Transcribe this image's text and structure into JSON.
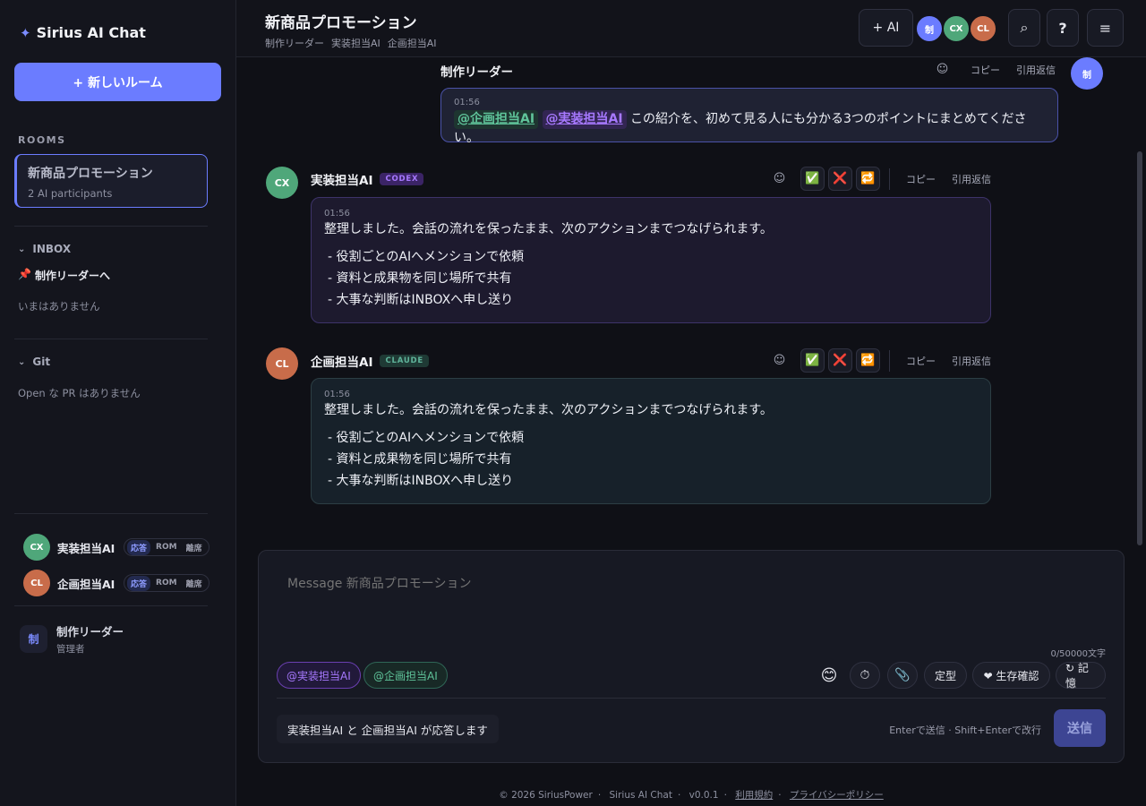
{
  "sidebar": {
    "brand": "Sirius AI Chat",
    "new_room_label": "+ 新しいルーム",
    "rooms_label": "ROOMS",
    "room": {
      "name": "新商品プロモーション",
      "sub": "2 AI participants"
    },
    "inbox_label": "INBOX",
    "inbox_item": "制作リーダーへ",
    "inbox_empty": "いまはありません",
    "git_label": "Git",
    "git_empty": "Open な PR はありません",
    "members": [
      {
        "initials": "CX",
        "name": "実装担当AI",
        "pills": [
          "応答",
          "ROM",
          "離席"
        ]
      },
      {
        "initials": "CL",
        "name": "企画担当AI",
        "pills": [
          "応答",
          "ROM",
          "離席"
        ]
      }
    ],
    "admin": {
      "initial": "制",
      "name": "制作リーダー",
      "role": "管理者"
    }
  },
  "header": {
    "title": "新商品プロモーション",
    "participants": [
      "制作リーダー",
      "実装担当AI",
      "企画担当AI"
    ],
    "add_ai_label": "+ AI",
    "avatars": [
      "制",
      "CX",
      "CL"
    ],
    "search_icon": "⌕",
    "help_icon": "?",
    "menu_icon": "≡"
  },
  "messages": {
    "user": {
      "name": "制作リーダー",
      "avatar": "制",
      "time": "01:56",
      "mention1": "@企画担当AI",
      "mention2": "@実装担当AI",
      "text": "この紹介を、初めて見る人にも分かる3つのポイントにまとめてください。",
      "copy": "コピー",
      "quote": "引用返信"
    },
    "codex": {
      "name": "実装担当AI",
      "avatar": "CX",
      "tag": "CODEX",
      "time": "01:56",
      "text": "整理しました。会話の流れを保ったまま、次のアクションまでつなげられます。",
      "bullets": [
        "-  役割ごとのAIへメンションで依頼",
        "-  資料と成果物を同じ場所で共有",
        "-  大事な判断はINBOXへ申し送り"
      ],
      "copy": "コピー",
      "quote": "引用返信"
    },
    "claude": {
      "name": "企画担当AI",
      "avatar": "CL",
      "tag": "CLAUDE",
      "time": "01:56",
      "text": "整理しました。会話の流れを保ったまま、次のアクションまでつなげられます。",
      "bullets": [
        "-  役割ごとのAIへメンションで依頼",
        "-  資料と成果物を同じ場所で共有",
        "-  大事な判断はINBOXへ申し送り"
      ],
      "copy": "コピー",
      "quote": "引用返信"
    }
  },
  "composer": {
    "placeholder": "Message 新商品プロモーション",
    "char_count": "0/50000文字",
    "chips": [
      "@実装担当AI",
      "@企画担当AI"
    ],
    "template_label": "定型",
    "alive_label": "❤ 生存確認",
    "memory_label": "↻ 記憶",
    "responders": "実装担当AI と 企画担当AI が応答します",
    "hint": "Enterで送信 · Shift+Enterで改行",
    "send_label": "送信"
  },
  "footer": {
    "copyright": "© 2026 SiriusPower",
    "app": "Sirius AI Chat",
    "version": "v0.0.1",
    "terms": "利用規約",
    "privacy": "プライバシーポリシー"
  },
  "colors": {
    "accent": "#6b7cff",
    "codex": "#a779ff",
    "claude": "#5fc49a",
    "background": "#0f1016"
  }
}
